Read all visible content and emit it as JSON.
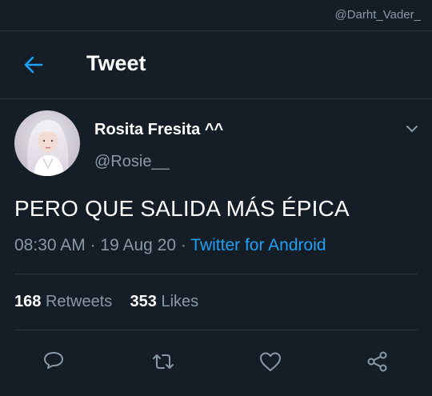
{
  "watermark": "@Darht_Vader_",
  "header": {
    "title": "Tweet"
  },
  "tweet": {
    "display_name": "Rosita Fresita ^^",
    "handle": "@Rosie__",
    "text": "PERO QUE SALIDA MÁS ÉPICA",
    "time": "08:30 AM",
    "separator1": " · ",
    "date": "19 Aug 20",
    "separator2": " · ",
    "source": "Twitter for Android"
  },
  "stats": {
    "retweets_count": "168",
    "retweets_label": "Retweets",
    "likes_count": "353",
    "likes_label": "Likes"
  },
  "icons": {
    "back": "arrow-left-icon",
    "menu": "chevron-down-icon",
    "reply": "reply-icon",
    "retweet": "retweet-icon",
    "like": "heart-icon",
    "share": "share-icon"
  },
  "colors": {
    "background": "#151d27",
    "accent": "#1da1f2",
    "secondary_text": "#8b98a5",
    "divider": "#2a3642"
  }
}
